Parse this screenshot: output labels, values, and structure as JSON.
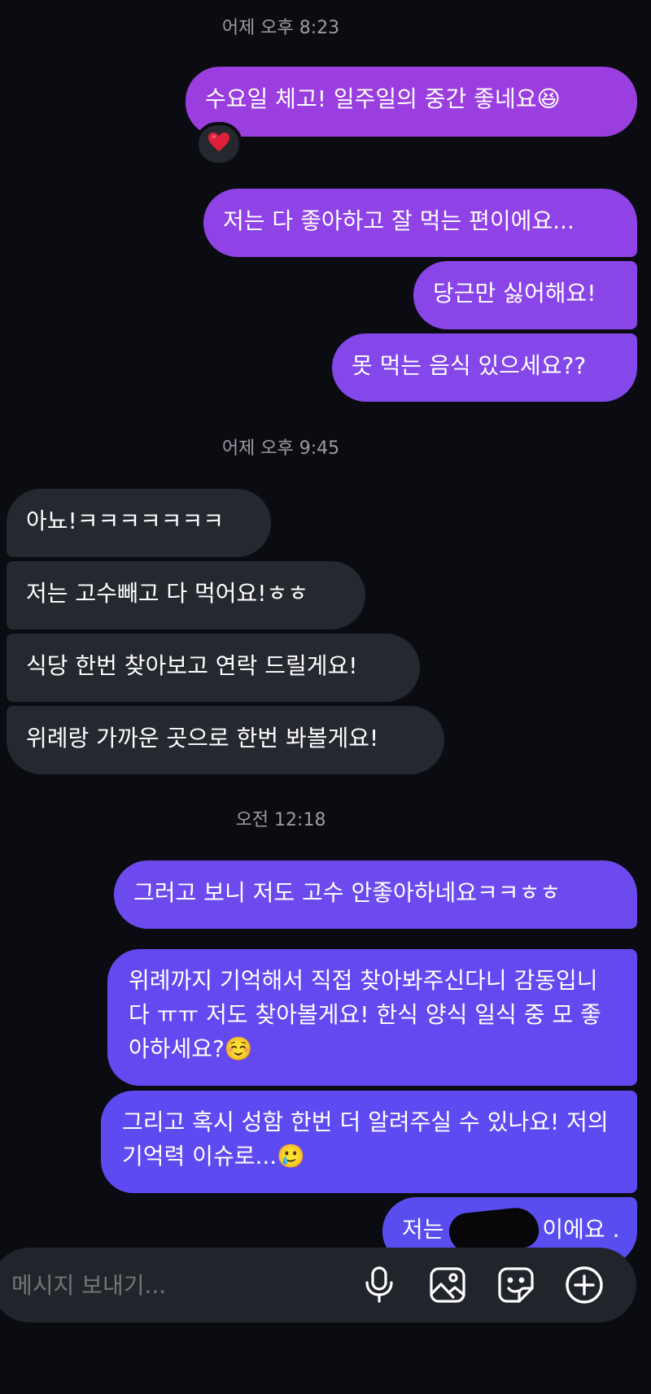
{
  "colors": {
    "background": "#0b0c12",
    "incoming_bubble": "#262830",
    "outgoing_purple": "#9a3ee0",
    "outgoing_indigo": "#5a4df0",
    "timestamp": "#9b9ca3"
  },
  "timestamps": [
    "어제 오후 8:23",
    "어제 오후 9:45",
    "오전 12:18"
  ],
  "messages": [
    {
      "dir": "out",
      "text": "수요일 체고! 일주일의 중간 좋네요😆",
      "reaction": "heart-emoji"
    },
    {
      "dir": "out",
      "text": "저는 다 좋아하고 잘 먹는 편이에요..."
    },
    {
      "dir": "out",
      "text": "당근만 싫어해요!"
    },
    {
      "dir": "out",
      "text": "못 먹는 음식 있으세요??"
    },
    {
      "dir": "in",
      "text": "아뇨!ㅋㅋㅋㅋㅋㅋㅋ"
    },
    {
      "dir": "in",
      "text": "저는 고수빼고 다 먹어요!ㅎㅎ"
    },
    {
      "dir": "in",
      "text": "식당 한번 찾아보고 연락 드릴게요!"
    },
    {
      "dir": "in",
      "text": "위례랑 가까운 곳으로 한번 봐볼게요!"
    },
    {
      "dir": "out",
      "text": "그러고 보니 저도 고수 안좋아하네요ㅋㅋㅎㅎ"
    },
    {
      "dir": "out",
      "text": "위례까지 기억해서 직접 찾아봐주신다니 감동입니다 ㅠㅠ 저도 찾아볼게요! 한식 양식 일식 중 모 좋아하세요?☺️"
    },
    {
      "dir": "out",
      "text": "그리고 혹시 성함 한번 더 알려주실 수 있나요! 저의 기억력 이슈로...🥲"
    },
    {
      "dir": "out",
      "text_before": "저는 ",
      "text_after": "이에요 ."
    }
  ],
  "composer": {
    "placeholder": "메시지 보내기...",
    "icons": [
      "microphone-icon",
      "image-icon",
      "sticker-icon",
      "plus-circle-icon"
    ]
  }
}
